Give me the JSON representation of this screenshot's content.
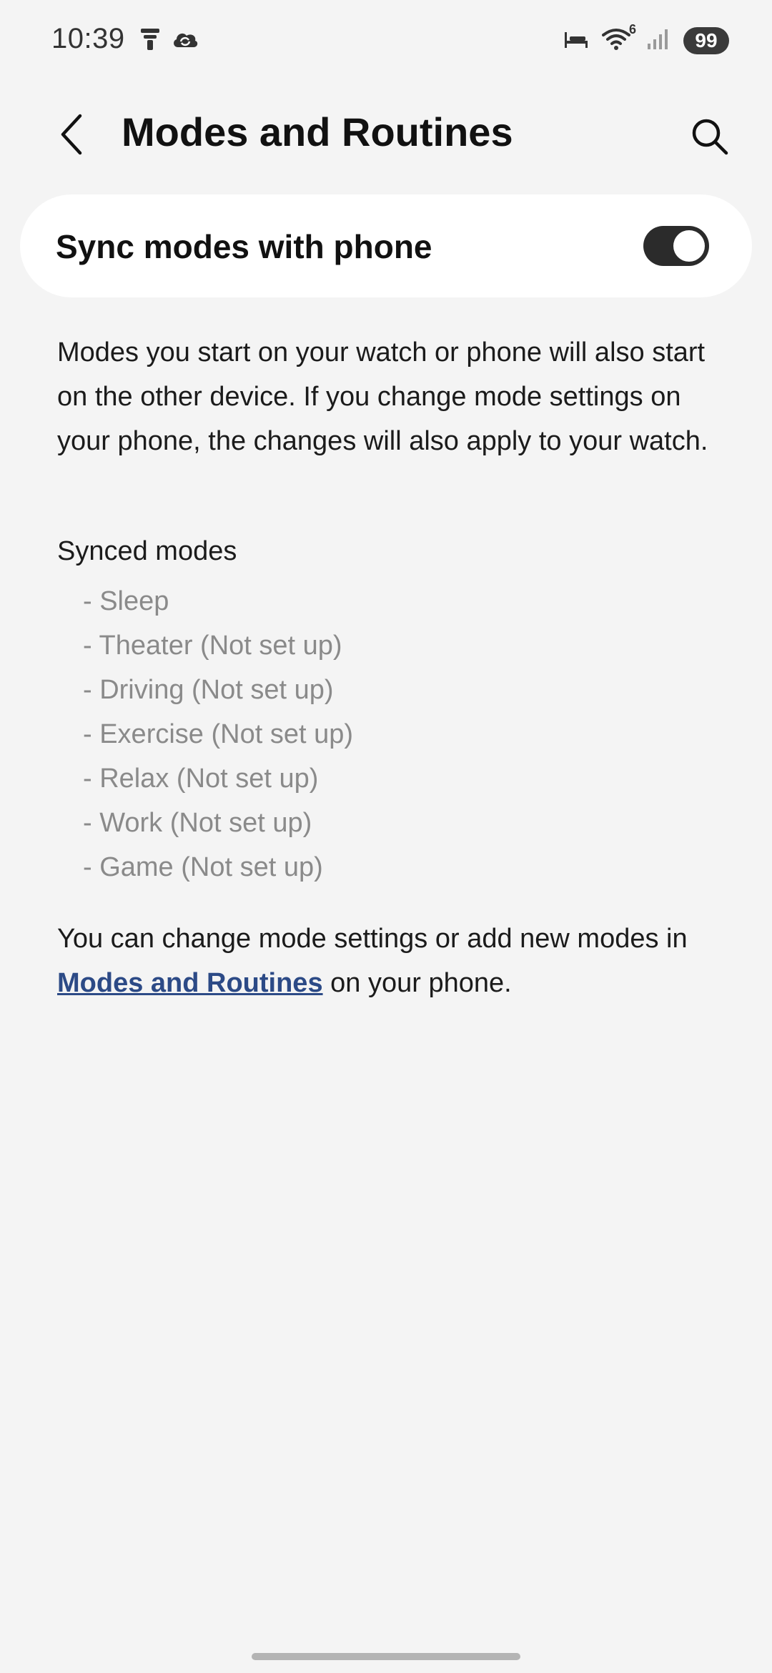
{
  "status_bar": {
    "time": "10:39",
    "battery": "99",
    "wifi_label": "6",
    "left_icons": [
      "sensor-icon",
      "cloud-sync-icon"
    ],
    "right_icons": [
      "bed-icon",
      "wifi-icon",
      "signal-icon"
    ]
  },
  "header": {
    "title": "Modes and Routines",
    "back_icon": "chevron-left-icon",
    "search_icon": "search-icon"
  },
  "sync_toggle": {
    "label": "Sync modes with phone",
    "state": "on"
  },
  "description": "Modes you start on your watch or phone will also start on the other device. If you change mode settings on your phone, the changes will also apply to your watch.",
  "synced_modes": {
    "heading": "Synced modes",
    "items": [
      "- Sleep",
      "- Theater (Not set up)",
      "- Driving (Not set up)",
      "- Exercise (Not set up)",
      "- Relax (Not set up)",
      "- Work (Not set up)",
      "- Game (Not set up)"
    ]
  },
  "footer": {
    "prefix": "You can change mode settings or add new modes in ",
    "link": "Modes and Routines",
    "suffix": " on your phone."
  },
  "colors": {
    "background": "#f4f4f4",
    "card": "#ffffff",
    "toggle_on": "#2b2b2b",
    "link": "#2c4a86",
    "muted_text": "#8a8a8a"
  }
}
